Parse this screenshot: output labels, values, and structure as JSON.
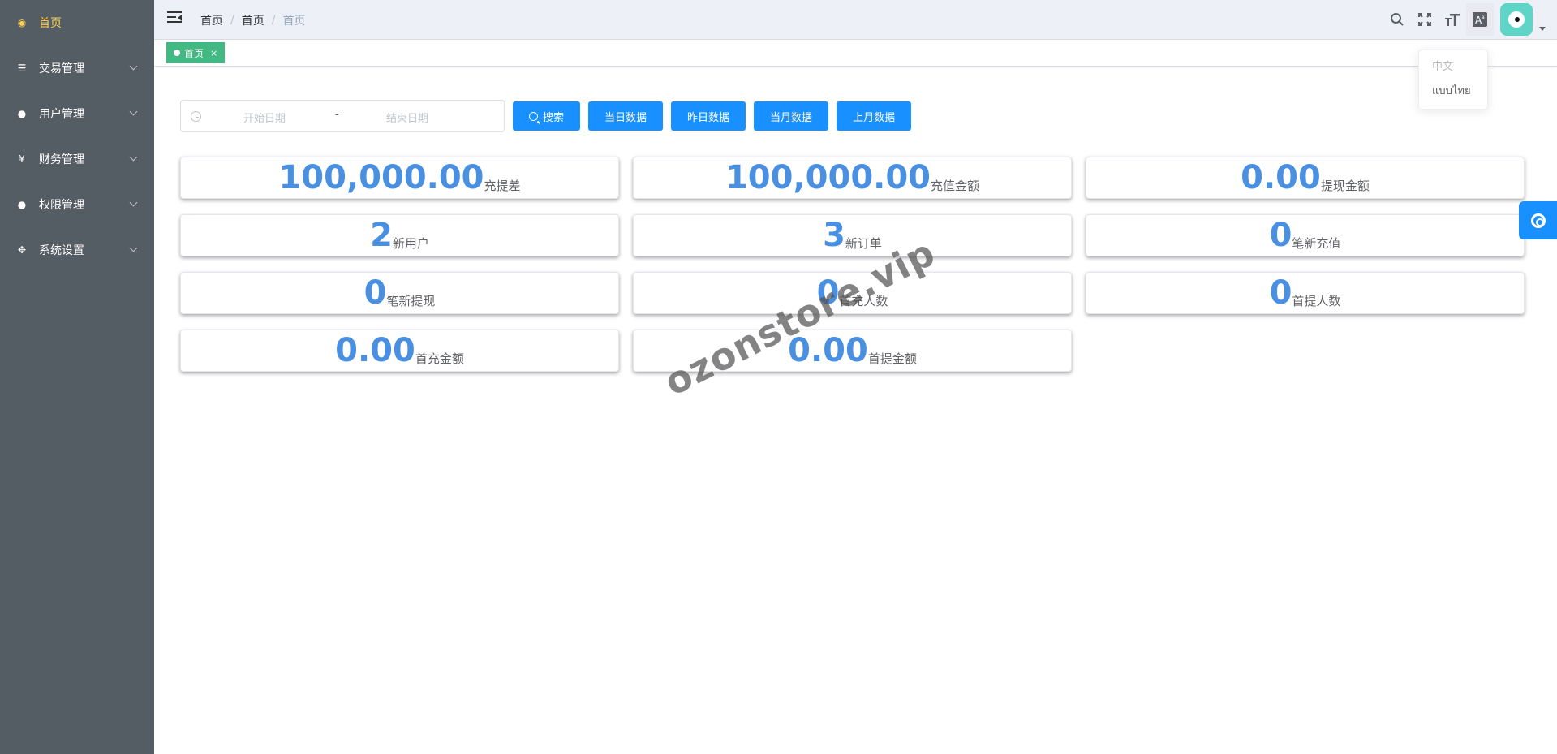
{
  "sidebar": {
    "items": [
      {
        "label": "首页",
        "icon": "dashboard-icon",
        "active": true
      },
      {
        "label": "交易管理",
        "icon": "list-icon"
      },
      {
        "label": "用户管理",
        "icon": "users-icon"
      },
      {
        "label": "财务管理",
        "icon": "yen-icon"
      },
      {
        "label": "权限管理",
        "icon": "user-icon"
      },
      {
        "label": "系统设置",
        "icon": "move-icon"
      }
    ]
  },
  "navbar": {
    "breadcrumb": [
      "首页",
      "首页",
      "首页"
    ],
    "tools": [
      "search-icon",
      "fullscreen-icon",
      "font-size-icon",
      "language-icon"
    ]
  },
  "tags": [
    {
      "label": "首页",
      "close": "×"
    }
  ],
  "language_dropdown": {
    "options": [
      "中文",
      "แบบไทย"
    ]
  },
  "filter": {
    "start_placeholder": "开始日期",
    "separator": "-",
    "end_placeholder": "结束日期",
    "search_label": "搜索",
    "buttons": [
      "当日数据",
      "昨日数据",
      "当月数据",
      "上月数据"
    ]
  },
  "stats": [
    {
      "value": "100,000.00",
      "label": "充提差"
    },
    {
      "value": "100,000.00",
      "label": "充值金额"
    },
    {
      "value": "0.00",
      "label": "提现金额"
    },
    {
      "value": "2",
      "label": "新用户"
    },
    {
      "value": "3",
      "label": "新订单"
    },
    {
      "value": "0",
      "label": "笔新充值"
    },
    {
      "value": "0",
      "label": "笔新提现"
    },
    {
      "value": "0",
      "label": "首充人数"
    },
    {
      "value": "0",
      "label": "首提人数"
    },
    {
      "value": "0.00",
      "label": "首充金额"
    },
    {
      "value": "0.00",
      "label": "首提金额"
    }
  ],
  "watermark": "ozonstore.vip",
  "colors": {
    "sidebar_bg": "#545c64",
    "active": "#ffd04b",
    "primary": "#1890ff",
    "tag": "#42b983",
    "stat_value": "#4a90e2"
  }
}
